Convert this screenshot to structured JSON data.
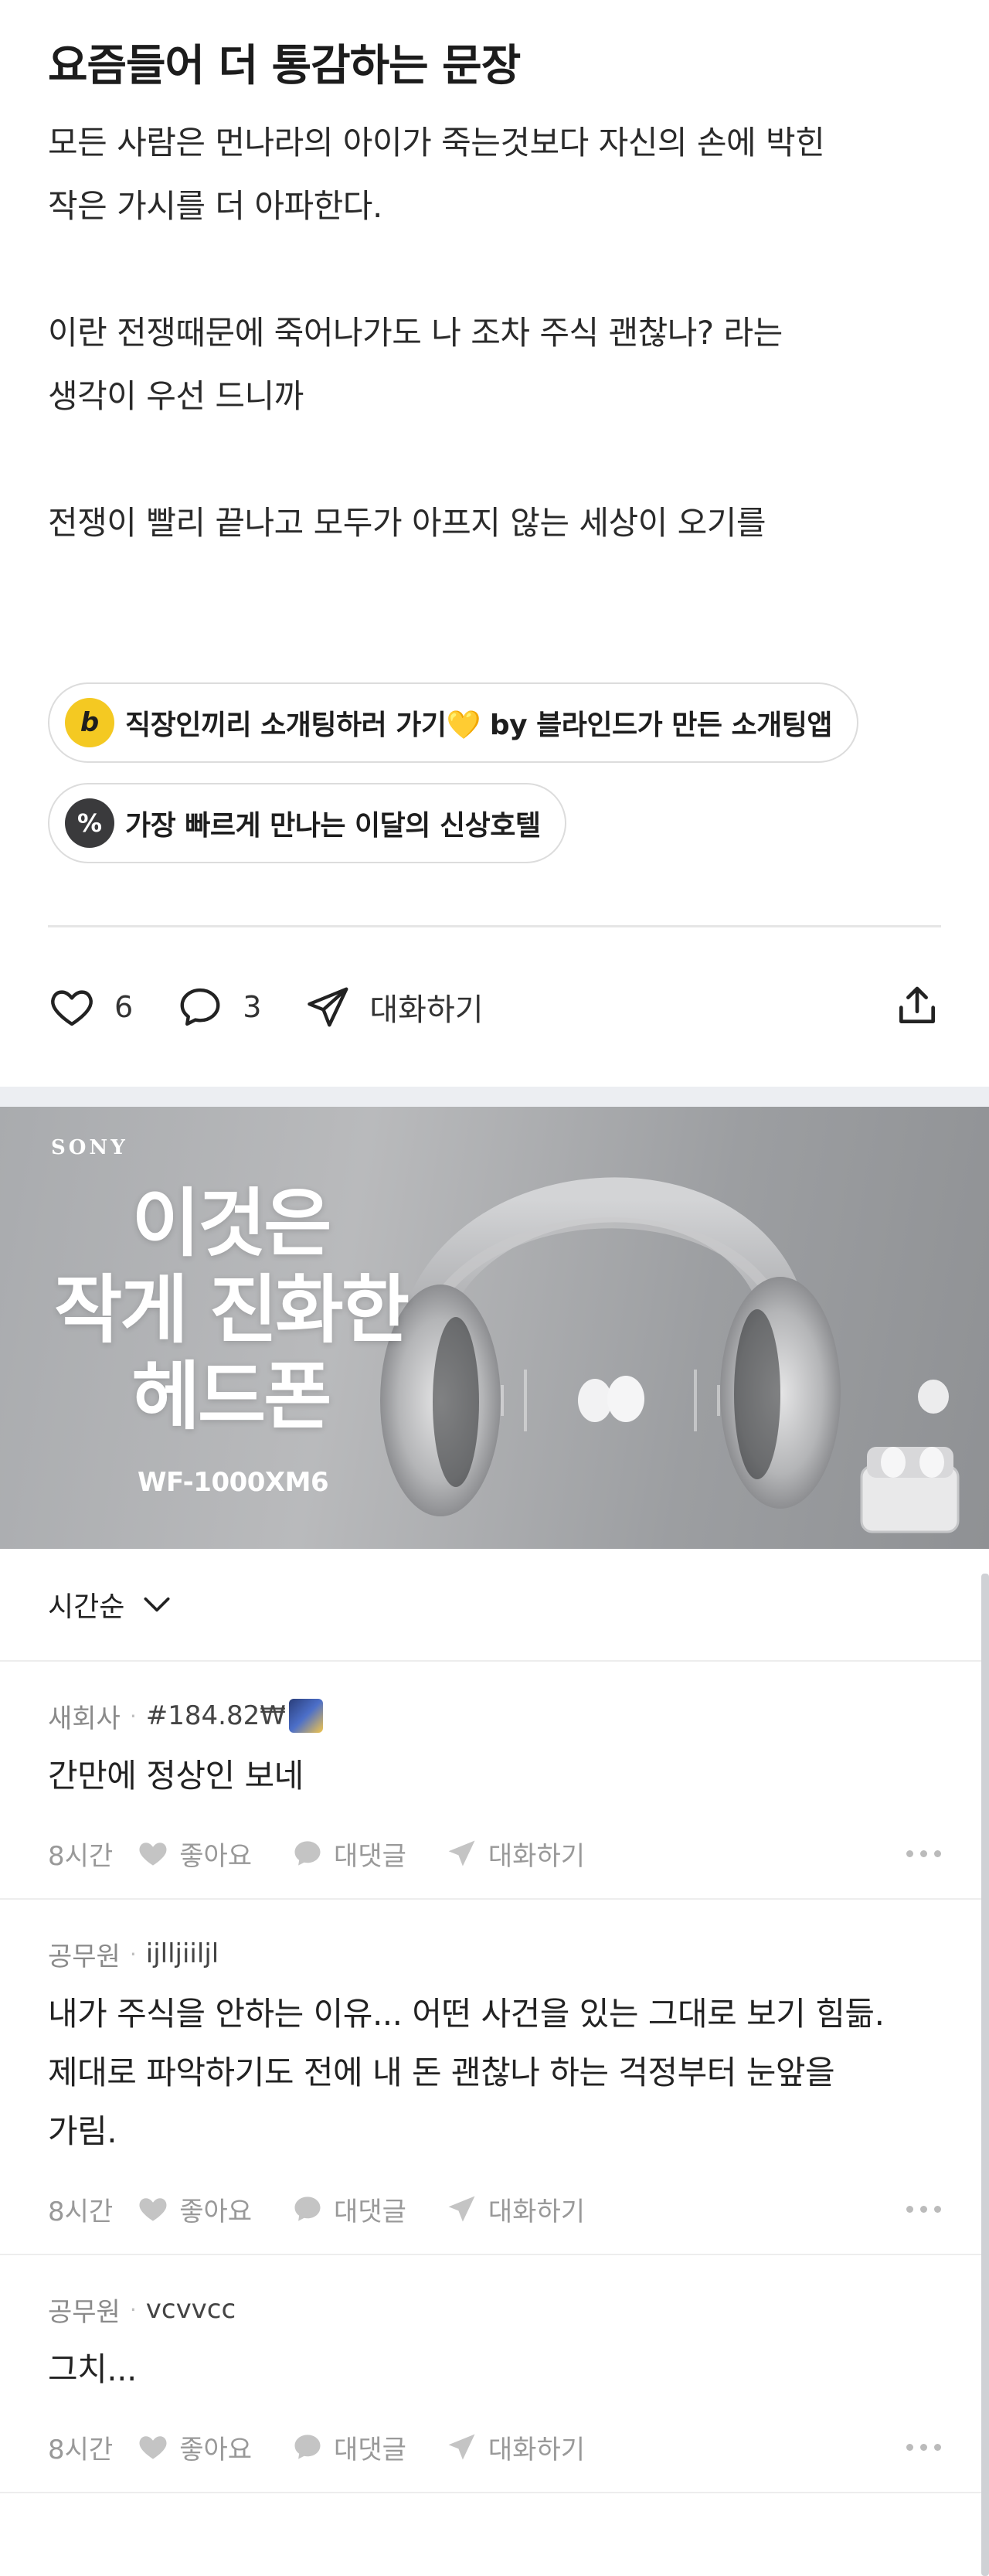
{
  "post": {
    "title": "요즘들어 더 통감하는 문장",
    "paragraphs": [
      [
        "모든 사람은 먼나라의 아이가 죽는것보다 자신의 손에 박힌",
        "작은 가시를 더 아파한다."
      ],
      [
        "이란 전쟁때문에 죽어나가도 나 조차 주식 괜찮나? 라는",
        "생각이 우선 드니까"
      ],
      [
        "전쟁이 빨리 끝나고 모두가 아프지 않는 세상이 오기를"
      ]
    ]
  },
  "chips": [
    {
      "icon": "b",
      "label": "직장인끼리 소개팅하러 가기",
      "heart": "💛",
      "label_suffix": " by 블라인드가 만든 소개팅앱"
    },
    {
      "icon": "%",
      "label": "가장 빠르게 만나는 이달의 신상호텔"
    }
  ],
  "actions": {
    "likes": "6",
    "comments": "3",
    "chat_label": "대화하기"
  },
  "ad": {
    "brand": "SONY",
    "headline": [
      "이것은",
      "작게 진화한",
      "헤드폰"
    ],
    "model": "WF-1000XM6"
  },
  "sort": {
    "label": "시간순"
  },
  "comments": [
    {
      "company": "새회사",
      "user": "#184.82₩",
      "has_emoji": true,
      "text": [
        "간만에 정상인 보네"
      ],
      "time": "8시간",
      "like_label": "좋아요",
      "reply_label": "대댓글",
      "chat_label": "대화하기"
    },
    {
      "company": "공무원",
      "user": "ijlljiiljl",
      "has_emoji": false,
      "text": [
        "내가 주식을 안하는 이유... 어떤 사건을 있는 그대로 보기 힘듦.",
        "제대로 파악하기도 전에 내 돈 괜찮나 하는 걱정부터 눈앞을",
        "가림."
      ],
      "time": "8시간",
      "like_label": "좋아요",
      "reply_label": "대댓글",
      "chat_label": "대화하기"
    },
    {
      "company": "공무원",
      "user": "vcvvcc",
      "has_emoji": false,
      "text": [
        "그치..."
      ],
      "time": "8시간",
      "like_label": "좋아요",
      "reply_label": "대댓글",
      "chat_label": "대화하기"
    }
  ],
  "colors": {
    "chip_b_bg": "#f4c922",
    "chip_pct_bg": "#3a3a3c",
    "section_gap": "#eceef2"
  }
}
